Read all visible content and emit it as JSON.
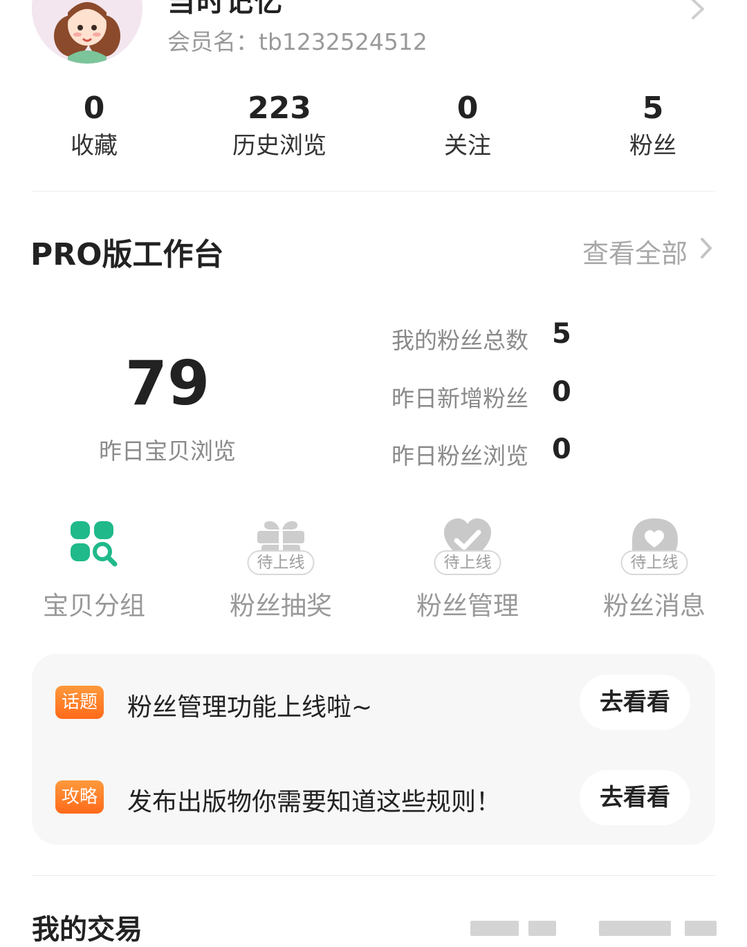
{
  "profile": {
    "nickname": "当时记忆",
    "member_label": "会员名：",
    "member_id": "tb1232524512"
  },
  "stats": [
    {
      "value": "0",
      "label": "收藏"
    },
    {
      "value": "223",
      "label": "历史浏览"
    },
    {
      "value": "0",
      "label": "关注"
    },
    {
      "value": "5",
      "label": "粉丝"
    }
  ],
  "workbench": {
    "title": "PRO版工作台",
    "view_all": "查看全部",
    "main_value": "79",
    "main_label": "昨日宝贝浏览",
    "metrics": [
      {
        "label": "我的粉丝总数",
        "value": "5"
      },
      {
        "label": "昨日新增粉丝",
        "value": "0"
      },
      {
        "label": "昨日粉丝浏览",
        "value": "0"
      }
    ]
  },
  "tools": [
    {
      "label": "宝贝分组",
      "icon": "grid-search-icon",
      "badge": ""
    },
    {
      "label": "粉丝抽奖",
      "icon": "gift-icon",
      "badge": "待上线"
    },
    {
      "label": "粉丝管理",
      "icon": "heart-check-icon",
      "badge": "待上线"
    },
    {
      "label": "粉丝消息",
      "icon": "message-heart-icon",
      "badge": "待上线"
    }
  ],
  "topics": [
    {
      "tag": "话题",
      "text": "粉丝管理功能上线啦~",
      "button": "去看看"
    },
    {
      "tag": "攻略",
      "text": "发布出版物你需要知道这些规则！",
      "button": "去看看"
    }
  ],
  "trades": {
    "title": "我的交易"
  },
  "colors": {
    "accent_green": "#1fb98a",
    "tag_orange": "#ff7a22",
    "muted_gray": "#9a9a9a",
    "card_bg": "#f7f7f7"
  }
}
